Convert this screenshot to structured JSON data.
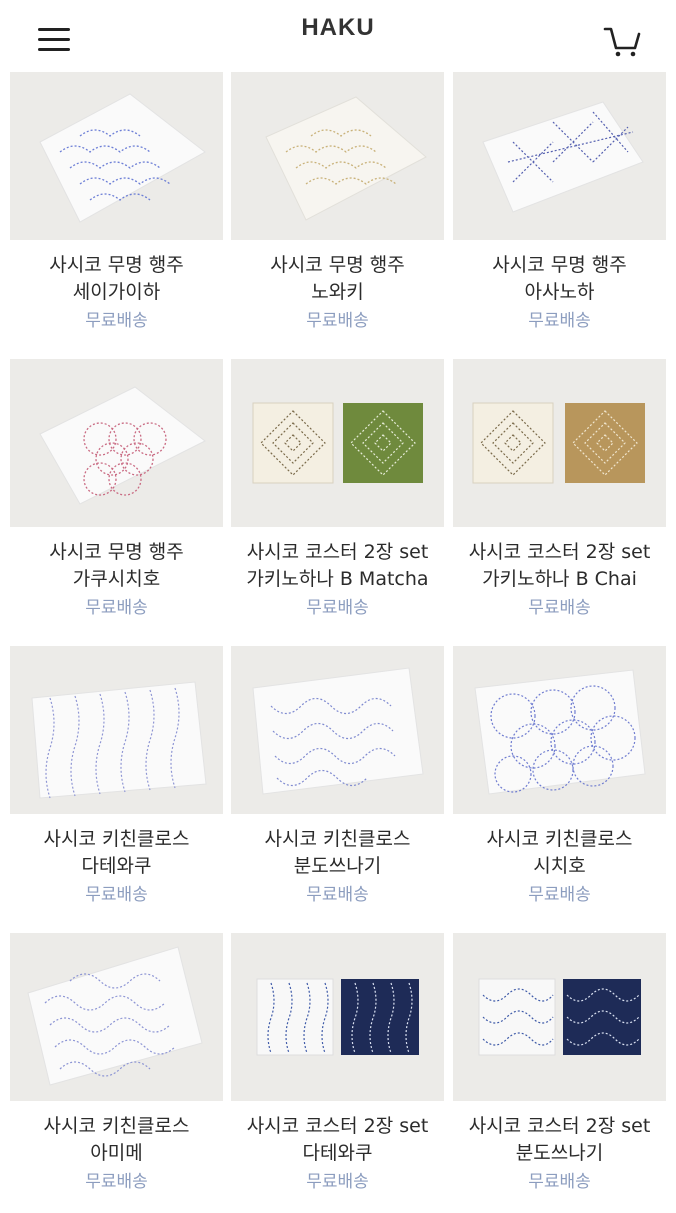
{
  "header": {
    "title": "HAKU",
    "menu_icon": "hamburger-menu-icon",
    "cart_icon": "cart-icon"
  },
  "products": [
    {
      "line1": "사시코 무명 행주",
      "line2": "세이가이하",
      "shipping": "무료배송"
    },
    {
      "line1": "사시코 무명 행주",
      "line2": "노와키",
      "shipping": "무료배송"
    },
    {
      "line1": "사시코 무명 행주",
      "line2": "아사노하",
      "shipping": "무료배송"
    },
    {
      "line1": "사시코 무명 행주",
      "line2": "가쿠시치호",
      "shipping": "무료배송"
    },
    {
      "line1": "사시코 코스터 2장 set",
      "line2": "가키노하나 B Matcha",
      "shipping": "무료배송"
    },
    {
      "line1": "사시코 코스터 2장 set",
      "line2": "가키노하나 B Chai",
      "shipping": "무료배송"
    },
    {
      "line1": "사시코 키친클로스",
      "line2": "다테와쿠",
      "shipping": "무료배송"
    },
    {
      "line1": "사시코 키친클로스",
      "line2": "분도쓰나기",
      "shipping": "무료배송"
    },
    {
      "line1": "사시코 키친클로스",
      "line2": "시치호",
      "shipping": "무료배송"
    },
    {
      "line1": "사시코 키친클로스",
      "line2": "아미메",
      "shipping": "무료배송"
    },
    {
      "line1": "사시코 코스터 2장 set",
      "line2": "다테와쿠",
      "shipping": "무료배송"
    },
    {
      "line1": "사시코 코스터 2장 set",
      "line2": "분도쓰나기",
      "shipping": "무료배송"
    }
  ]
}
